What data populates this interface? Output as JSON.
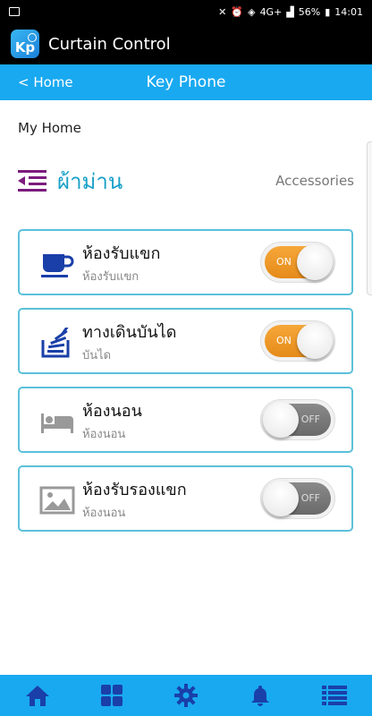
{
  "status_bar": {
    "network": "4G+",
    "battery": "56%",
    "time": "14:01"
  },
  "app": {
    "title": "Curtain Control",
    "logo_letters": "Kp"
  },
  "nav": {
    "back_label": "< Home",
    "title": "Key Phone"
  },
  "home_label": "My Home",
  "section": {
    "title": "ผ้าม่าน",
    "accessories_label": "Accessories"
  },
  "rooms": [
    {
      "name": "ห้องรับแขก",
      "sub": "ห้องรับแขก",
      "icon": "coffee-cup-icon",
      "state": "ON"
    },
    {
      "name": "ทางเดินบันได",
      "sub": "บันได",
      "icon": "stairs-icon",
      "state": "ON"
    },
    {
      "name": "ห้องนอน",
      "sub": "ห้องนอน",
      "icon": "bed-icon",
      "state": "OFF"
    },
    {
      "name": "ห้องรับรองแขก",
      "sub": "ห้องนอน",
      "icon": "picture-icon",
      "state": "OFF"
    }
  ],
  "bottom_nav": [
    "home-icon",
    "grid-icon",
    "gear-icon",
    "bell-icon",
    "list-icon"
  ],
  "colors": {
    "accent": "#19a9f0",
    "section_title": "#19a0c8",
    "section_icon": "#7b1b7c",
    "card_border": "#5bc0da",
    "toggle_on": "#f6a739",
    "toggle_off": "#7a7a7a",
    "icon_active": "#1a3fa8",
    "icon_inactive": "#999999"
  }
}
